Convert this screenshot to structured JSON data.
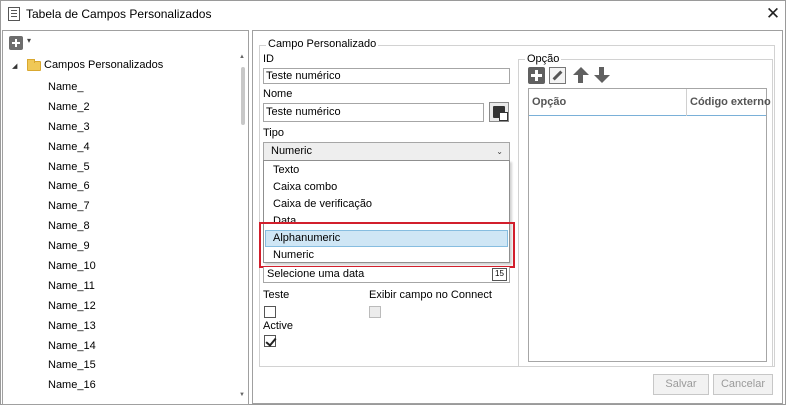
{
  "window": {
    "title": "Tabela de Campos Personalizados",
    "close_glyph": "✕"
  },
  "left_pane": {
    "root_label": "Campos Personalizados",
    "items": [
      "Name_",
      "Name_2",
      "Name_3",
      "Name_4",
      "Name_5",
      "Name_6",
      "Name_7",
      "Name_8",
      "Name_9",
      "Name_10",
      "Name_11",
      "Name_12",
      "Name_13",
      "Name_14",
      "Name_15",
      "Name_16"
    ]
  },
  "form": {
    "group_title": "Campo Personalizado",
    "id_label": "ID",
    "id_value": "Teste numérico",
    "name_label": "Nome",
    "name_value": "Teste numérico",
    "type_label": "Tipo",
    "type_selected": "Numeric",
    "type_options": [
      "Texto",
      "Caixa combo",
      "Caixa de verificação",
      "Data",
      "Alphanumeric",
      "Numeric"
    ],
    "hovered_option": "Alphanumeric",
    "date_placeholder": "Selecione uma data",
    "calendar_day": "15",
    "teste_label": "Teste",
    "connect_label": "Exibir campo no Connect",
    "active_label": "Active"
  },
  "options": {
    "group_title": "Opção",
    "columns": [
      "Opção",
      "Código externo"
    ]
  },
  "buttons": {
    "save": "Salvar",
    "cancel": "Cancelar"
  },
  "colors": {
    "highlight_border": "#d21f2c",
    "hover_bg": "#cfe6f5",
    "folder": "#f0c856"
  }
}
